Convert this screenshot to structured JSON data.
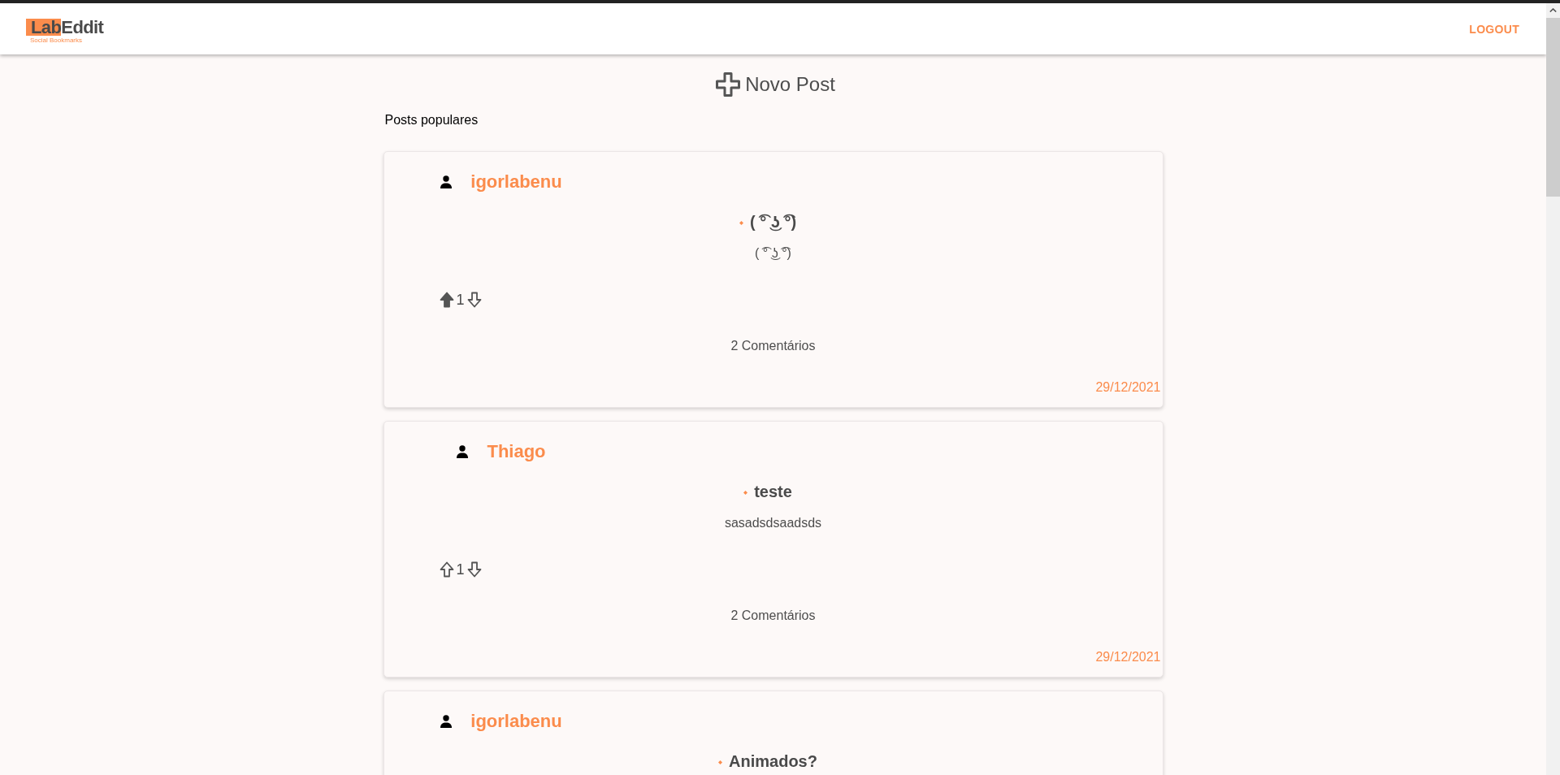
{
  "header": {
    "logo": {
      "highlighted": "Lab",
      "rest": "Eddit",
      "tagline": "Social Bookmarks"
    },
    "logout": "LOGOUT"
  },
  "new_post": {
    "label": "Novo Post"
  },
  "section_title": "Posts populares",
  "posts": [
    {
      "author": "igorlabenu",
      "title": "( ͡° ͜ʖ ͡°)",
      "body": "( ͡° ͜ʖ ͡°)",
      "votes": {
        "count": "1",
        "upvoted": true,
        "downvoted": false
      },
      "comments": "2 Comentários",
      "date": "29/12/2021"
    },
    {
      "author": "Thiago",
      "title": "teste",
      "body": "sasadsdsaadsds",
      "votes": {
        "count": "1",
        "upvoted": false,
        "downvoted": false
      },
      "comments": "2 Comentários",
      "date": "29/12/2021"
    },
    {
      "author": "igorlabenu",
      "title": "Animados?"
    }
  ]
}
